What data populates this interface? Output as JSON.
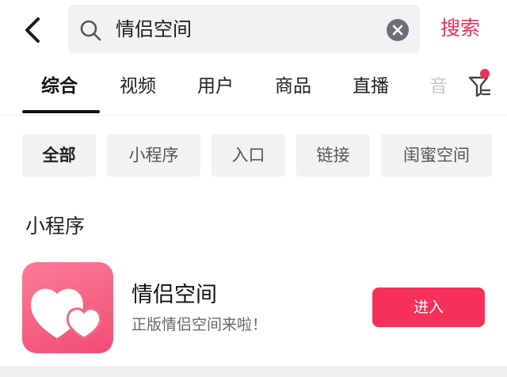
{
  "header": {
    "back_icon": "chevron-left-icon",
    "search_query": "情侣空间",
    "search_icon": "search-icon",
    "clear_icon": "clear-icon",
    "search_submit_label": "搜索",
    "accent_color": "#f0305a"
  },
  "tabs": [
    {
      "label": "综合",
      "active": true
    },
    {
      "label": "视频"
    },
    {
      "label": "用户"
    },
    {
      "label": "商品"
    },
    {
      "label": "直播"
    },
    {
      "label": "音"
    }
  ],
  "filter": {
    "icon": "filter-icon",
    "has_badge": true
  },
  "chips": [
    {
      "label": "全部",
      "active": true
    },
    {
      "label": "小程序"
    },
    {
      "label": "入口"
    },
    {
      "label": "链接"
    },
    {
      "label": "闺蜜空间"
    }
  ],
  "section": {
    "title": "小程序"
  },
  "app": {
    "icon": "heart-icon",
    "name": "情侣空间",
    "description": "正版情侣空间来啦！",
    "button_label": "进入"
  }
}
